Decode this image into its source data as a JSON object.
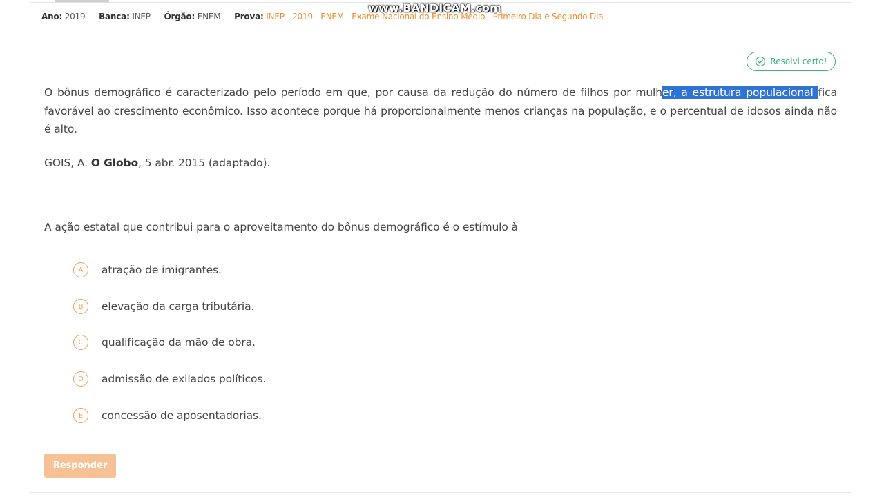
{
  "header": {
    "ano_label": "Ano:",
    "ano_value": "2019",
    "banca_label": "Banca:",
    "banca_value": "INEP",
    "orgao_label": "Órgão:",
    "orgao_value": "ENEM",
    "prova_label": "Prova:",
    "prova_value": "INEP - 2019 - ENEM - Exame Nacional do Ensino Médio - Primeiro Dia e Segundo Dia"
  },
  "watermark": "www.BANDICAM.com",
  "status_badge": {
    "label": "Resolvi certo!",
    "icon": "check-circle-icon"
  },
  "question": {
    "text_part1": "O bônus demográfico é caracterizado pelo período em que, por causa da redução do número de filhos por mulh",
    "text_highlighted": "er, a estrutura populacional ",
    "text_part2": "fica favorável ao crescimento econômico. Isso acontece porque há proporcionalmente menos crianças na população, e o percentual de idosos ainda não é alto.",
    "source_author": "GOIS, A.",
    "source_publication": "O Globo",
    "source_rest": ", 5 abr. 2015 (adaptado).",
    "prompt": "A ação estatal que contribui para o aproveitamento do bônus demográfico é o estímulo à"
  },
  "options": [
    {
      "letter": "A",
      "text": "atração de imigrantes."
    },
    {
      "letter": "B",
      "text": "elevação da carga tributária."
    },
    {
      "letter": "C",
      "text": "qualificação da mão de obra."
    },
    {
      "letter": "D",
      "text": "admissão de exilados políticos."
    },
    {
      "letter": "E",
      "text": "concessão de aposentadorias."
    }
  ],
  "respond_button": "Responder",
  "colors": {
    "accent": "#f08a2a",
    "success": "#3db37a",
    "highlight": "#3073d7",
    "button_disabled": "#f6c194"
  }
}
